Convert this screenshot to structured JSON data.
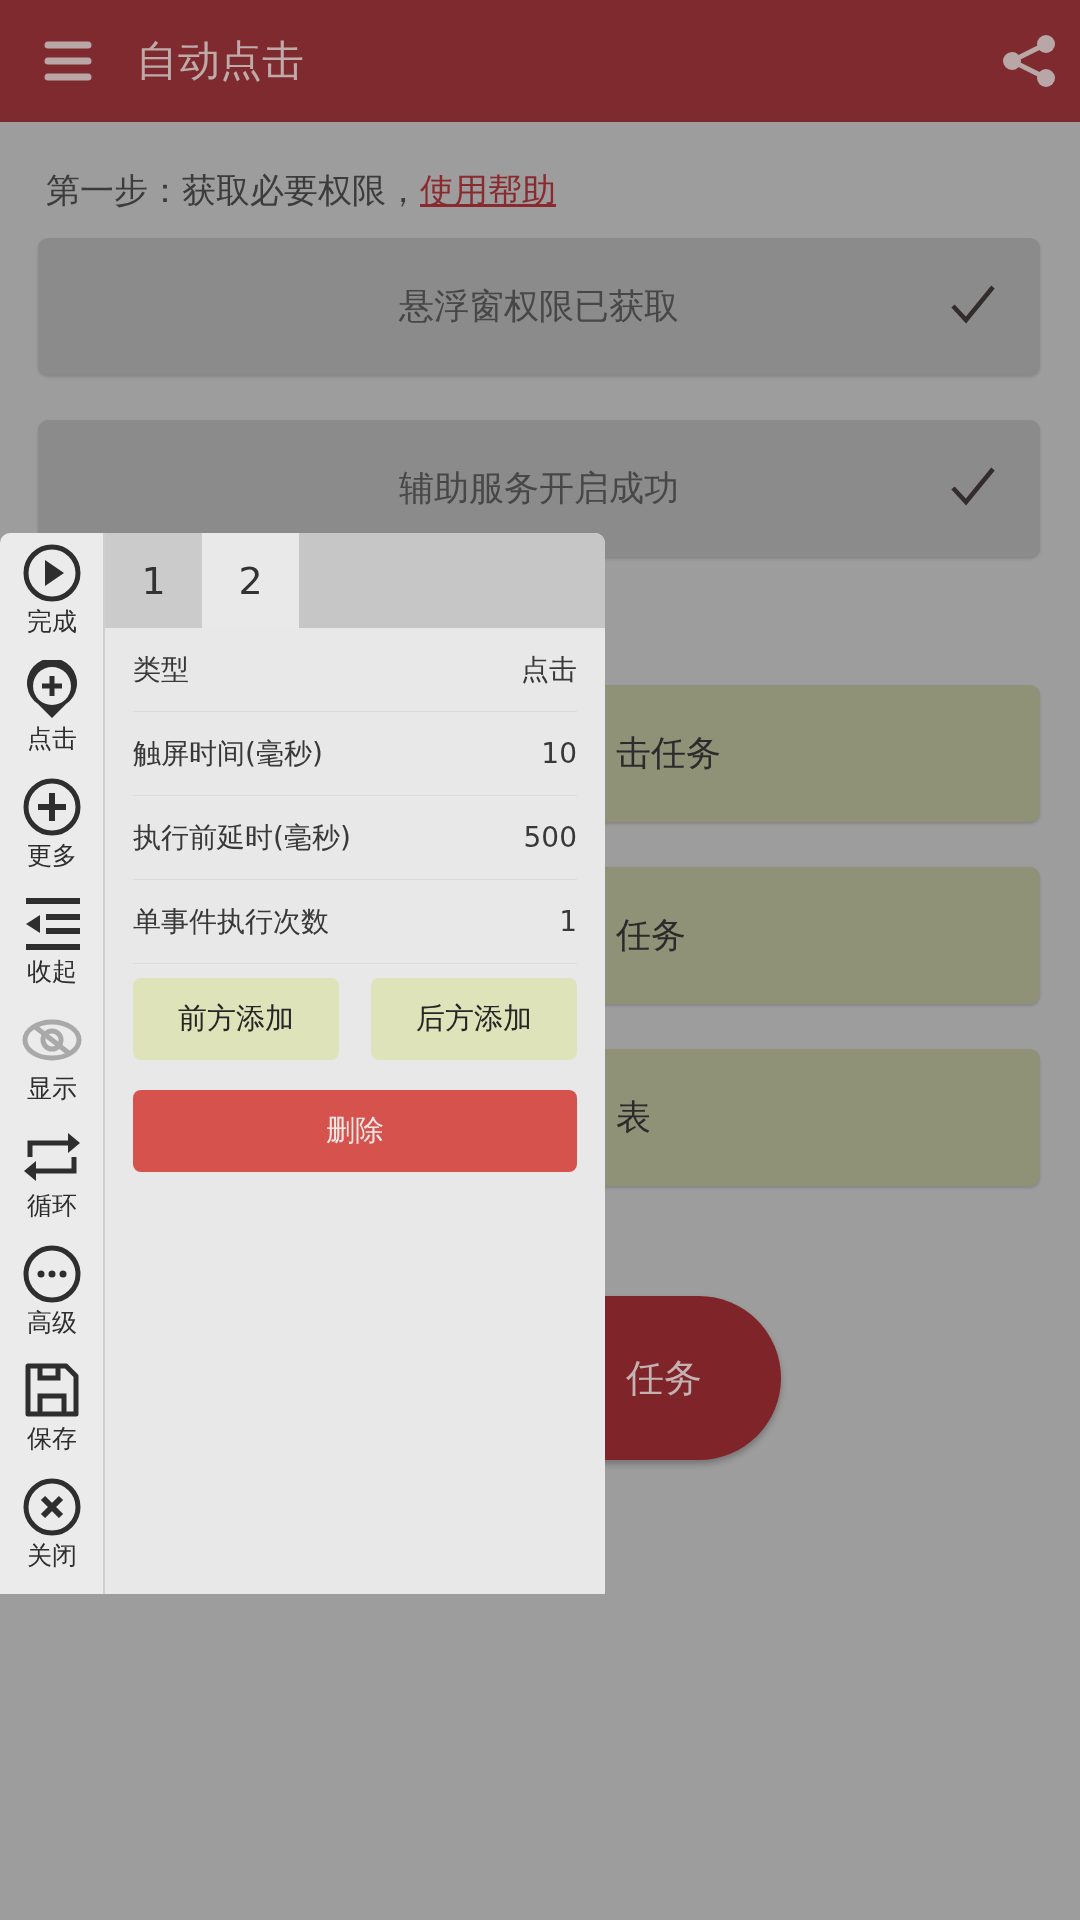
{
  "app_bar": {
    "title": "自动点击"
  },
  "step_one": {
    "text": "第一步：获取必要权限，",
    "link": "使用帮助"
  },
  "permissions": [
    {
      "label": "悬浮窗权限已获取",
      "granted": true
    },
    {
      "label": "辅助服务开启成功",
      "granted": true
    }
  ],
  "actions": [
    {
      "label": "击任务"
    },
    {
      "label": "任务"
    },
    {
      "label": "表"
    }
  ],
  "start_button": {
    "label": "任务"
  },
  "float_panel": {
    "toolbar": [
      {
        "label": "完成",
        "disabled": false
      },
      {
        "label": "点击",
        "disabled": false
      },
      {
        "label": "更多",
        "disabled": false
      },
      {
        "label": "收起",
        "disabled": false
      },
      {
        "label": "显示",
        "disabled": true
      },
      {
        "label": "循环",
        "disabled": false
      },
      {
        "label": "高级",
        "disabled": false
      },
      {
        "label": "保存",
        "disabled": false
      },
      {
        "label": "关闭",
        "disabled": false
      }
    ],
    "tabs": [
      {
        "label": "1",
        "selected": false
      },
      {
        "label": "2",
        "selected": true
      }
    ],
    "properties": [
      {
        "name": "类型",
        "value": "点击"
      },
      {
        "name": "触屏时间(毫秒)",
        "value": "10"
      },
      {
        "name": "执行前延时(毫秒)",
        "value": "500"
      },
      {
        "name": "单事件执行次数",
        "value": "1"
      }
    ],
    "add_buttons": [
      "前方添加",
      "后方添加"
    ],
    "delete_button": "删除"
  }
}
